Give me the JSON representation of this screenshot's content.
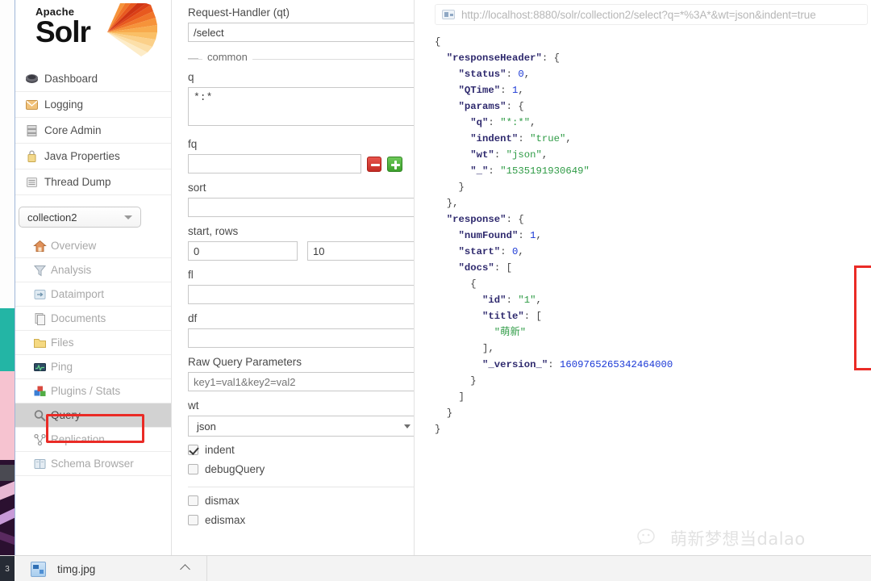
{
  "logo": {
    "apache": "Apache",
    "solr": "Solr",
    "sun_icon": "solr-sunburst-icon"
  },
  "sidebar": {
    "primary_items": [
      {
        "label": "Dashboard",
        "icon": "dashboard-icon"
      },
      {
        "label": "Logging",
        "icon": "logging-icon"
      },
      {
        "label": "Core Admin",
        "icon": "core-admin-icon"
      },
      {
        "label": "Java Properties",
        "icon": "java-properties-icon"
      },
      {
        "label": "Thread Dump",
        "icon": "thread-dump-icon"
      }
    ],
    "collection_selected": "collection2",
    "core_items": [
      {
        "label": "Overview",
        "icon": "overview-home-icon",
        "active": false
      },
      {
        "label": "Analysis",
        "icon": "analysis-funnel-icon",
        "active": false
      },
      {
        "label": "Dataimport",
        "icon": "dataimport-icon",
        "active": false
      },
      {
        "label": "Documents",
        "icon": "documents-icon",
        "active": false
      },
      {
        "label": "Files",
        "icon": "files-folder-icon",
        "active": false
      },
      {
        "label": "Ping",
        "icon": "ping-icon",
        "active": false
      },
      {
        "label": "Plugins / Stats",
        "icon": "plugins-stats-icon",
        "active": false
      },
      {
        "label": "Query",
        "icon": "query-magnifier-icon",
        "active": true
      },
      {
        "label": "Replication",
        "icon": "replication-icon",
        "active": false
      },
      {
        "label": "Schema Browser",
        "icon": "schema-browser-icon",
        "active": false
      }
    ]
  },
  "query_form": {
    "request_handler_label": "Request-Handler (qt)",
    "request_handler_value": "/select",
    "common_legend": "common",
    "q_label": "q",
    "q_value": "*:*",
    "fq_label": "fq",
    "fq_value": "",
    "fq_remove_icon": "minus-button",
    "fq_add_icon": "plus-button",
    "sort_label": "sort",
    "sort_value": "",
    "start_rows_label": "start, rows",
    "start_value": "0",
    "rows_value": "10",
    "fl_label": "fl",
    "fl_value": "",
    "df_label": "df",
    "df_value": "",
    "raw_params_label": "Raw Query Parameters",
    "raw_params_placeholder": "key1=val1&key2=val2",
    "raw_params_value": "",
    "wt_label": "wt",
    "wt_value": "json",
    "checkboxes": [
      {
        "label": "indent",
        "checked": true
      },
      {
        "label": "debugQuery",
        "checked": false
      },
      {
        "label": "dismax",
        "checked": false
      },
      {
        "label": "edismax",
        "checked": false
      }
    ]
  },
  "result": {
    "url_icon": "new-window-icon",
    "url": "http://localhost:8880/solr/collection2/select?q=*%3A*&wt=json&indent=true",
    "response_json": {
      "responseHeader": {
        "status": 0,
        "QTime": 1,
        "params": {
          "q": "*:*",
          "indent": "true",
          "wt": "json",
          "_": "1535191930649"
        }
      },
      "response": {
        "numFound": 1,
        "start": 0,
        "docs": [
          {
            "id": "1",
            "title": [
              "萌新"
            ],
            "_version_": 1609765265342464000
          }
        ]
      }
    },
    "highlight_color": "#ea2b26"
  },
  "watermark": {
    "icon": "wechat-icon",
    "text": "萌新梦想当dalao"
  },
  "download_bar": {
    "gutter_label": "3",
    "file_name": "timg.jpg",
    "caret_icon": "chevron-up-icon"
  }
}
